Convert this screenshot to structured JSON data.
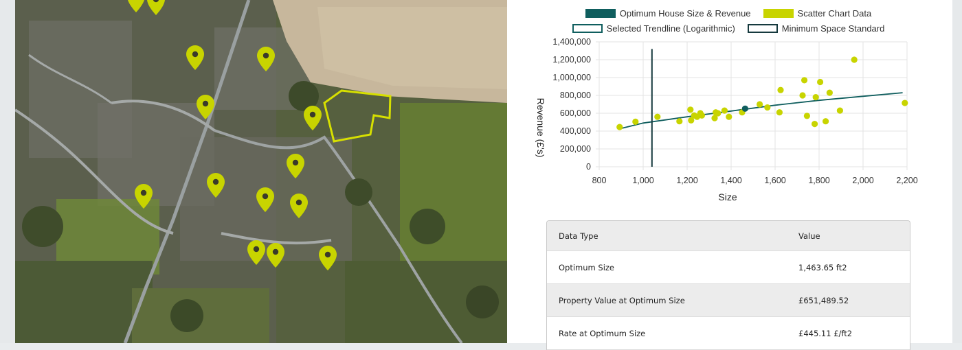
{
  "map": {
    "marker_color": "#c8d400",
    "site_outline_color": "#d7e000"
  },
  "legend": {
    "items": [
      {
        "label": "Optimum House Size & Revenue",
        "color": "#0f5e5e",
        "style": "filled"
      },
      {
        "label": "Scatter Chart Data",
        "color": "#c8d400",
        "style": "filled"
      },
      {
        "label": "Selected Trendline (Logarithmic)",
        "color": "#0f5e5e",
        "style": "outline"
      },
      {
        "label": "Minimum Space Standard",
        "color": "#163a3e",
        "style": "outline"
      }
    ]
  },
  "chart_data": {
    "type": "scatter",
    "xlabel": "Size",
    "ylabel": "Revenue (£'s)",
    "xlim": [
      800,
      2200
    ],
    "ylim": [
      0,
      1400000
    ],
    "x_ticks": [
      "800",
      "1,000",
      "1,200",
      "1,400",
      "1,600",
      "1,800",
      "2,000",
      "2,200"
    ],
    "y_ticks": [
      "0",
      "200,000",
      "400,000",
      "600,000",
      "800,000",
      "1,000,000",
      "1,200,000",
      "1,400,000"
    ],
    "grid": true,
    "legend_position": "top",
    "series": [
      {
        "name": "Scatter Chart Data",
        "color": "#c8d400",
        "points": [
          [
            893,
            445000
          ],
          [
            965,
            505000
          ],
          [
            1065,
            560000
          ],
          [
            1165,
            510000
          ],
          [
            1215,
            640000
          ],
          [
            1218,
            520000
          ],
          [
            1232,
            575000
          ],
          [
            1245,
            560000
          ],
          [
            1260,
            600000
          ],
          [
            1267,
            575000
          ],
          [
            1325,
            545000
          ],
          [
            1330,
            610000
          ],
          [
            1340,
            600000
          ],
          [
            1370,
            630000
          ],
          [
            1390,
            560000
          ],
          [
            1450,
            610000
          ],
          [
            1530,
            700000
          ],
          [
            1565,
            665000
          ],
          [
            1620,
            610000
          ],
          [
            1625,
            860000
          ],
          [
            1725,
            800000
          ],
          [
            1733,
            970000
          ],
          [
            1745,
            570000
          ],
          [
            1780,
            480000
          ],
          [
            1785,
            780000
          ],
          [
            1805,
            950000
          ],
          [
            1830,
            510000
          ],
          [
            1848,
            830000
          ],
          [
            1895,
            630000
          ],
          [
            1960,
            1200000
          ],
          [
            2190,
            715000
          ]
        ]
      },
      {
        "name": "Optimum House Size & Revenue",
        "color": "#0f5e5e",
        "points": [
          [
            1463.65,
            651489.52
          ]
        ]
      },
      {
        "name": "Selected Trendline (Logarithmic)",
        "color": "#0f5e5e",
        "line": [
          [
            900,
            430000
          ],
          [
            1000,
            490000
          ],
          [
            1200,
            560000
          ],
          [
            1400,
            625000
          ],
          [
            1600,
            690000
          ],
          [
            1800,
            745000
          ],
          [
            2000,
            790000
          ],
          [
            2180,
            830000
          ]
        ]
      },
      {
        "name": "Minimum Space Standard",
        "color": "#163a3e",
        "vertical_line_x": 1040,
        "y_range": [
          0,
          1320000
        ]
      }
    ]
  },
  "table": {
    "header": {
      "col1": "Data Type",
      "col2": "Value"
    },
    "rows": [
      {
        "label": "Optimum Size",
        "value": "1,463.65 ft2"
      },
      {
        "label": "Property Value at Optimum Size",
        "value": "£651,489.52"
      },
      {
        "label": "Rate at Optimum Size",
        "value": "£445.11 £/ft2"
      }
    ]
  }
}
